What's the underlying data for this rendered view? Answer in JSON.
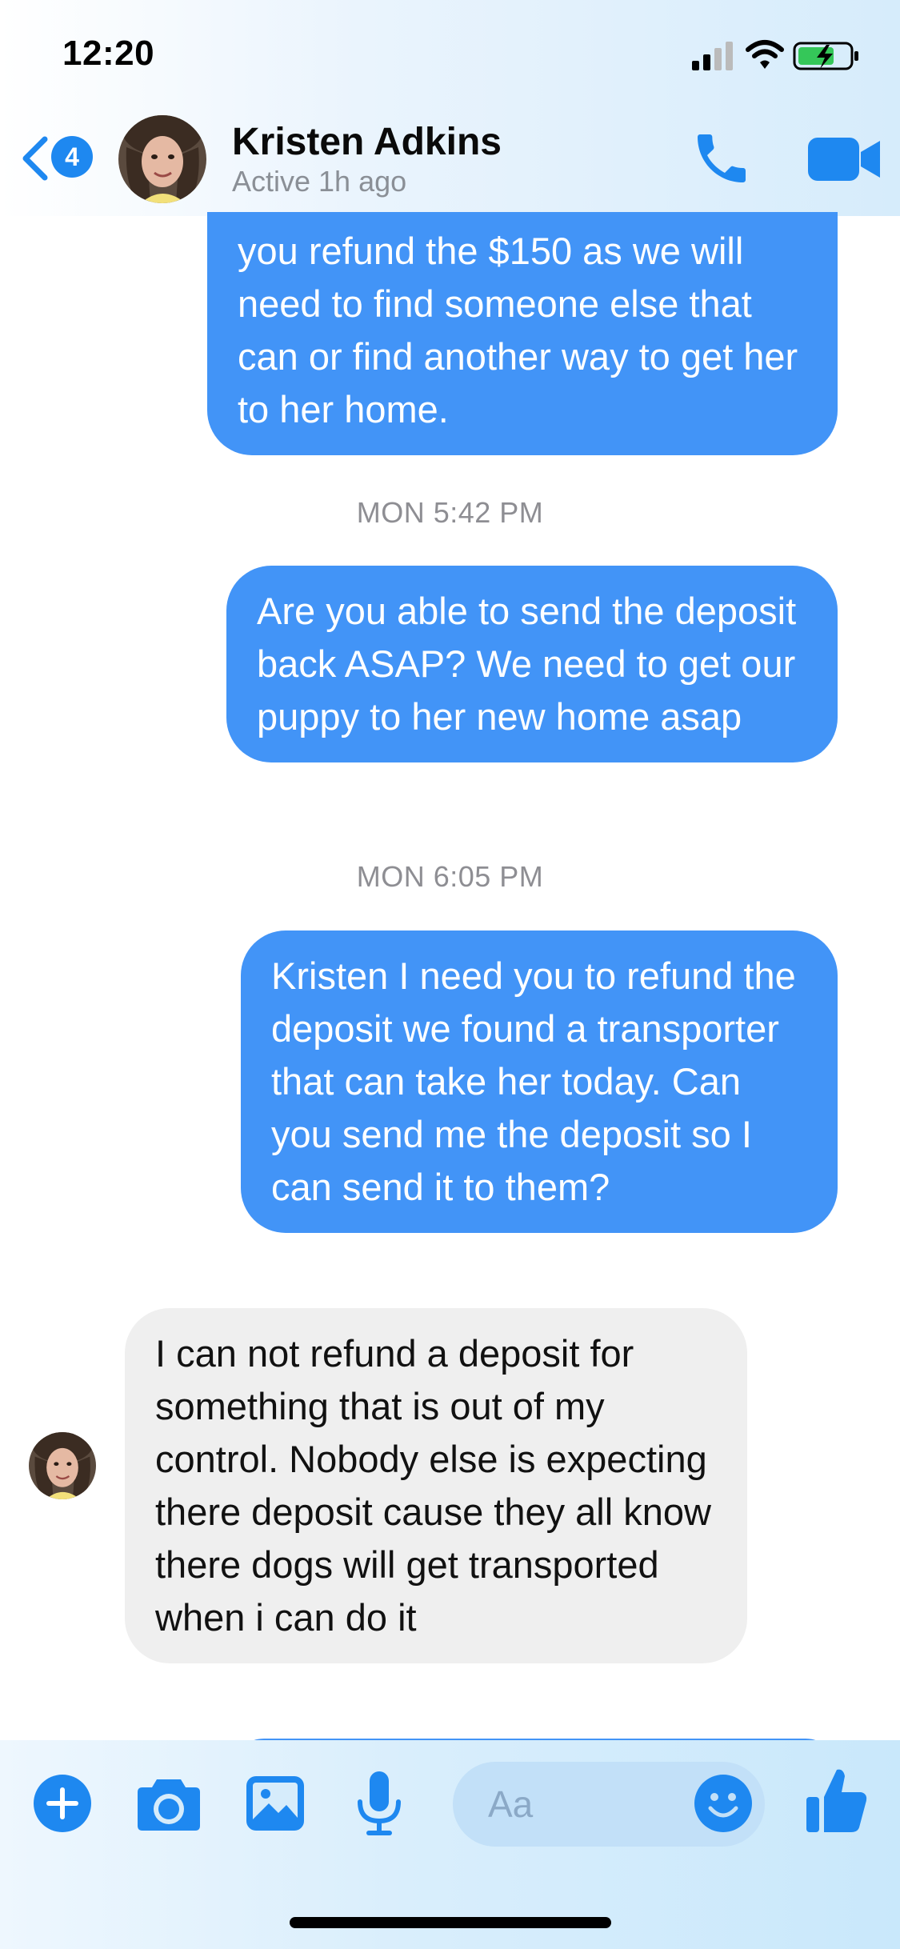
{
  "status_bar": {
    "time": "12:20"
  },
  "header": {
    "unread_count": "4",
    "contact_name": "Kristen Adkins",
    "active_status": "Active 1h ago"
  },
  "messages": [
    {
      "type": "outgoing",
      "text": "you refund the $150 as we will need to find someone else that can or find another way to get her to her home."
    },
    {
      "type": "timestamp",
      "text": "MON 5:42 PM"
    },
    {
      "type": "outgoing",
      "text": "Are you able to send the deposit back ASAP? We need to get our puppy to her new home asap"
    },
    {
      "type": "timestamp",
      "text": "MON 6:05 PM"
    },
    {
      "type": "outgoing",
      "text": "Kristen I need you to refund the deposit we found a transporter that can take her today. Can you send me the deposit so I can send it to them?"
    },
    {
      "type": "incoming",
      "text": "I can not refund a deposit for something that is out of my control. Nobody else is expecting there deposit cause they all know there dogs will get transported when i can do it"
    }
  ],
  "composer": {
    "placeholder": "Aa"
  },
  "colors": {
    "accent": "#1e88f0",
    "outgoing_bubble": "#4294f7",
    "incoming_bubble": "#efefef"
  },
  "icons": [
    "back-chevron-icon",
    "phone-icon",
    "video-camera-icon",
    "plus-icon",
    "camera-icon",
    "gallery-icon",
    "microphone-icon",
    "emoji-icon",
    "thumbs-up-icon"
  ]
}
